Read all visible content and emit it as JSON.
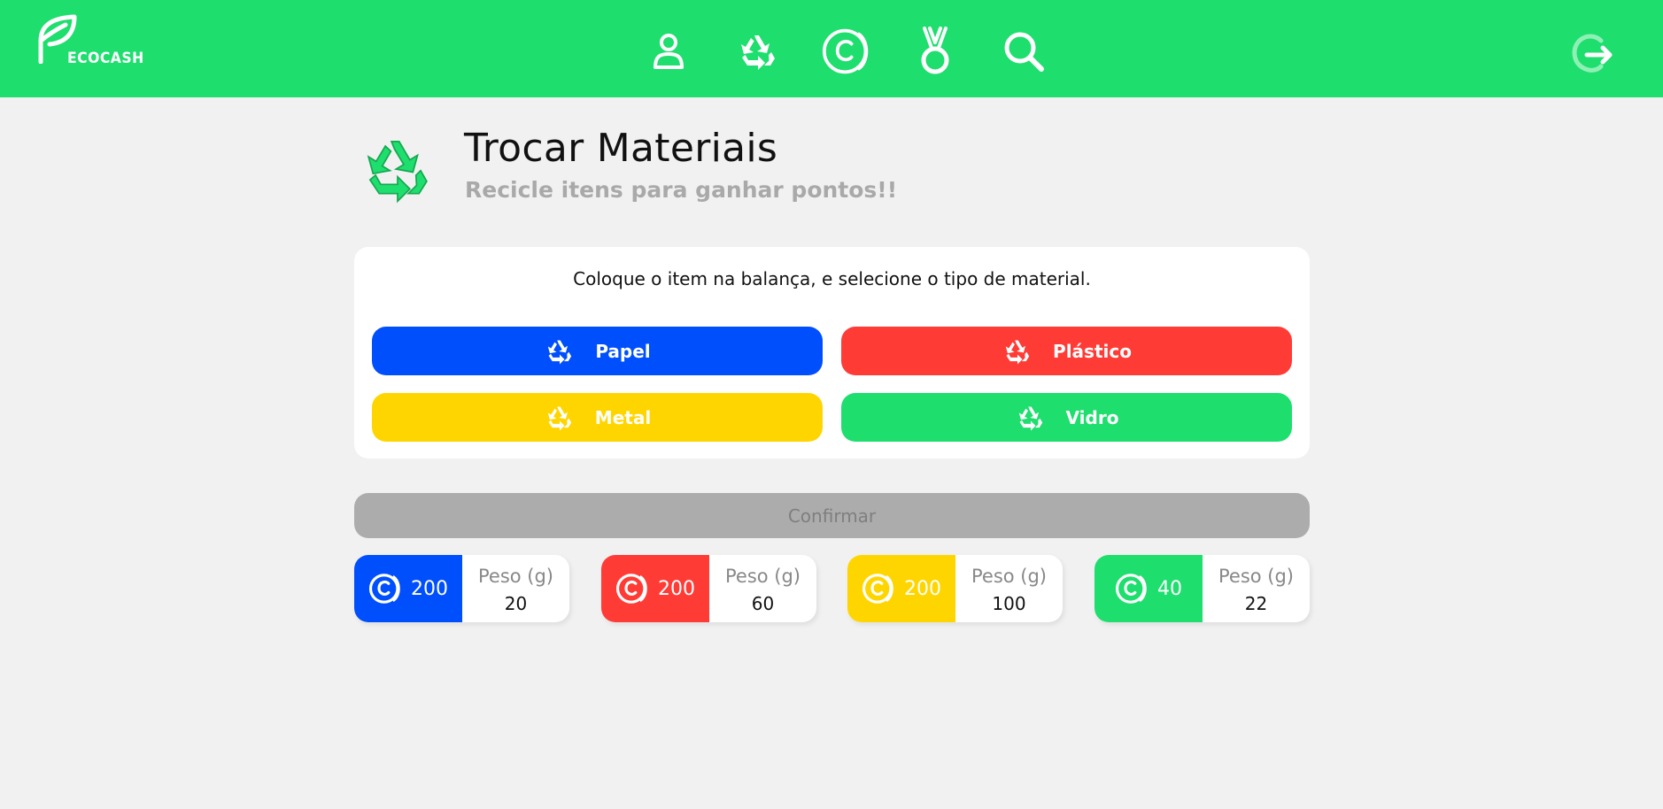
{
  "app": {
    "brand": "ECOCASH"
  },
  "colors": {
    "brand_green": "#1ede6e",
    "papel": "#004ffd",
    "plastico": "#ff3b36",
    "metal": "#ffd500",
    "vidro": "#1ede6e",
    "confirm_disabled": "#acacac"
  },
  "nav": [
    {
      "icon": "user-icon"
    },
    {
      "icon": "recycle-icon"
    },
    {
      "icon": "coin-icon"
    },
    {
      "icon": "medal-icon"
    },
    {
      "icon": "search-icon"
    }
  ],
  "header": {
    "logout_icon": "logout-icon"
  },
  "page": {
    "title": "Trocar Materiais",
    "subtitle": "Recicle itens para ganhar pontos!!"
  },
  "card": {
    "instruction": "Coloque o item na balança, e selecione o tipo de material.",
    "materials": [
      {
        "label": "Papel",
        "color": "#004ffd"
      },
      {
        "label": "Plástico",
        "color": "#ff3b36"
      },
      {
        "label": "Metal",
        "color": "#ffd500"
      },
      {
        "label": "Vidro",
        "color": "#1ede6e"
      }
    ]
  },
  "confirm_label": "Confirmar",
  "summaries": [
    {
      "points": "200",
      "peso_label": "Peso (g)",
      "peso": "20",
      "color": "#004ffd"
    },
    {
      "points": "200",
      "peso_label": "Peso (g)",
      "peso": "60",
      "color": "#ff3b36"
    },
    {
      "points": "200",
      "peso_label": "Peso (g)",
      "peso": "100",
      "color": "#ffd500"
    },
    {
      "points": "40",
      "peso_label": "Peso (g)",
      "peso": "22",
      "color": "#1ede6e"
    }
  ]
}
